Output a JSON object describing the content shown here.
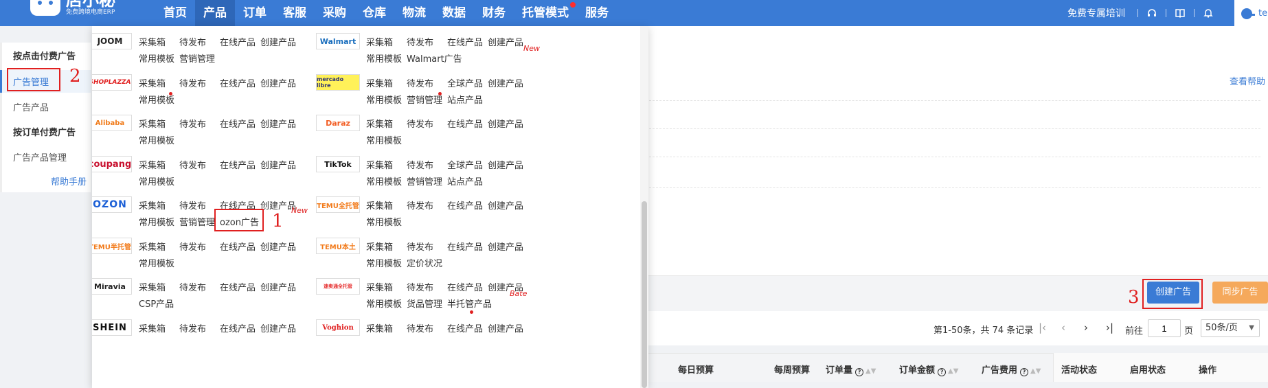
{
  "app": {
    "name": "店小秘",
    "subtitle": "免费跨境电商ERP"
  },
  "nav": {
    "items": [
      {
        "label": "首页"
      },
      {
        "label": "产品"
      },
      {
        "label": "订单"
      },
      {
        "label": "客服"
      },
      {
        "label": "采购"
      },
      {
        "label": "仓库"
      },
      {
        "label": "物流"
      },
      {
        "label": "数据"
      },
      {
        "label": "财务"
      },
      {
        "label": "托管模式"
      },
      {
        "label": "服务"
      }
    ],
    "active_index": 1,
    "dot_index": 9,
    "training": "免费专属培训",
    "user_initial": "te"
  },
  "sidebar": {
    "group1": "按点击付费广告",
    "ad_manage": "广告管理",
    "ad_product": "广告产品",
    "group2": "按订单付费广告",
    "ad_product_manage": "广告产品管理",
    "help": "帮助手册"
  },
  "annotations": {
    "n1": "1",
    "n2": "2",
    "n3": "3"
  },
  "main": {
    "help_link": "查看帮助",
    "create_button": "创建广告",
    "sync_button": "同步广告",
    "pager": {
      "total": "第1-50条，共 74 条记录",
      "goto_label": "前往",
      "page_value": "1",
      "page_unit": "页",
      "page_size": "50条/页"
    },
    "columns": {
      "daily_budget": "每日预算",
      "weekly_budget": "每周预算",
      "orders": "订单量",
      "order_amount": "订单金额",
      "ad_cost": "广告费用",
      "activity_status": "活动状态",
      "enable_status": "启用状态",
      "actions": "操作"
    }
  },
  "dropdown": {
    "left": [
      {
        "platform": "JOOM",
        "row1": [
          "采集箱",
          "待发布",
          "在线产品",
          "创建产品"
        ],
        "row2": [
          "常用模板",
          "营销管理"
        ]
      },
      {
        "platform": "SHOPLAZZA",
        "row1": [
          "采集箱",
          "待发布",
          "在线产品",
          "创建产品"
        ],
        "row2": [
          "常用模板"
        ]
      },
      {
        "platform": "Alibaba",
        "row1": [
          "采集箱",
          "待发布",
          "在线产品",
          "创建产品"
        ],
        "row2": [
          "常用模板"
        ]
      },
      {
        "platform": "coupang",
        "row1": [
          "采集箱",
          "待发布",
          "在线产品",
          "创建产品"
        ],
        "row2": [
          "常用模板"
        ]
      },
      {
        "platform": "OZON",
        "row1": [
          "采集箱",
          "待发布",
          "在线产品",
          "创建产品"
        ],
        "row2": [
          "常用模板",
          "营销管理",
          "ozon广告"
        ]
      },
      {
        "platform": "TEMU半托管",
        "row1": [
          "采集箱",
          "待发布",
          "在线产品",
          "创建产品"
        ],
        "row2": [
          "常用模板"
        ]
      },
      {
        "platform": "Miravia",
        "row1": [
          "采集箱",
          "待发布",
          "在线产品",
          "创建产品"
        ],
        "row2": [
          "CSP产品"
        ]
      },
      {
        "platform": "SHEIN",
        "row1": [
          "采集箱",
          "待发布",
          "在线产品",
          "创建产品"
        ],
        "row2": []
      }
    ],
    "right": [
      {
        "platform": "Walmart",
        "row1": [
          "采集箱",
          "待发布",
          "在线产品",
          "创建产品"
        ],
        "row2": [
          "常用模板",
          "Walmart广告"
        ]
      },
      {
        "platform": "mercado libre",
        "row1": [
          "采集箱",
          "待发布",
          "全球产品",
          "创建产品"
        ],
        "row2": [
          "常用模板",
          "营销管理",
          "站点产品"
        ]
      },
      {
        "platform": "Daraz",
        "row1": [
          "采集箱",
          "待发布",
          "在线产品",
          "创建产品"
        ],
        "row2": [
          "常用模板"
        ]
      },
      {
        "platform": "TikTok",
        "row1": [
          "采集箱",
          "待发布",
          "全球产品",
          "创建产品"
        ],
        "row2": [
          "常用模板",
          "营销管理",
          "站点产品"
        ]
      },
      {
        "platform": "TEMU全托管",
        "row1": [
          "采集箱",
          "待发布",
          "在线产品",
          "创建产品"
        ],
        "row2": [
          "常用模板"
        ]
      },
      {
        "platform": "TEMU本土",
        "row1": [
          "采集箱",
          "待发布",
          "在线产品",
          "创建产品"
        ],
        "row2": [
          "常用模板",
          "定价状况"
        ]
      },
      {
        "platform": "速卖通全托管",
        "row1": [
          "采集箱",
          "待发布",
          "在线产品",
          "创建产品"
        ],
        "row2": [
          "常用模板",
          "货品管理",
          "半托管产品"
        ]
      },
      {
        "platform": "Voghion",
        "row1": [
          "采集箱",
          "待发布",
          "在线产品",
          "创建产品"
        ],
        "row2": []
      }
    ],
    "badges": {
      "new1": "New",
      "new2": "New",
      "bate": "Bate"
    }
  },
  "colors": {
    "brand_blue": "#3a7bd5",
    "accent_red": "#e02020",
    "sync_orange": "#f5a95c"
  }
}
